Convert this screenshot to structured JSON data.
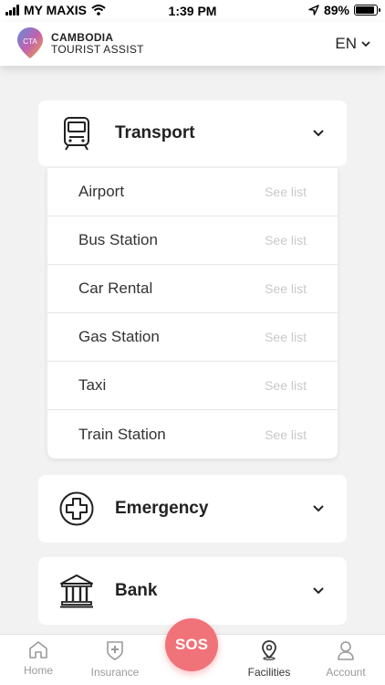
{
  "status_bar": {
    "carrier": "MY MAXIS",
    "time": "1:39 PM",
    "battery": "89%",
    "battery_level": 0.89
  },
  "header": {
    "brand_line1": "CAMBODIA",
    "brand_line2": "TOURIST ASSIST",
    "logo_text": "CTA",
    "language": "EN"
  },
  "categories": [
    {
      "title": "Transport",
      "icon": "train-icon",
      "expanded": true,
      "items": [
        {
          "label": "Airport",
          "action": "See list"
        },
        {
          "label": "Bus Station",
          "action": "See list"
        },
        {
          "label": "Car Rental",
          "action": "See list"
        },
        {
          "label": "Gas Station",
          "action": "See list"
        },
        {
          "label": "Taxi",
          "action": "See list"
        },
        {
          "label": "Train Station",
          "action": "See list"
        }
      ]
    },
    {
      "title": "Emergency",
      "icon": "medical-cross-icon",
      "expanded": false
    },
    {
      "title": "Bank",
      "icon": "bank-icon",
      "expanded": false
    }
  ],
  "tab_bar": {
    "tabs": [
      {
        "label": "Home",
        "icon": "home-icon"
      },
      {
        "label": "Insurance",
        "icon": "insurance-icon"
      },
      {
        "label": "SOS",
        "icon": "sos-button"
      },
      {
        "label": "Facilities",
        "icon": "location-pin-icon"
      },
      {
        "label": "Account",
        "icon": "person-icon"
      }
    ],
    "active": "Facilities"
  },
  "colors": {
    "accent": "#f0737a",
    "background": "#f2f2f2",
    "muted_text": "#c9c9c9"
  }
}
